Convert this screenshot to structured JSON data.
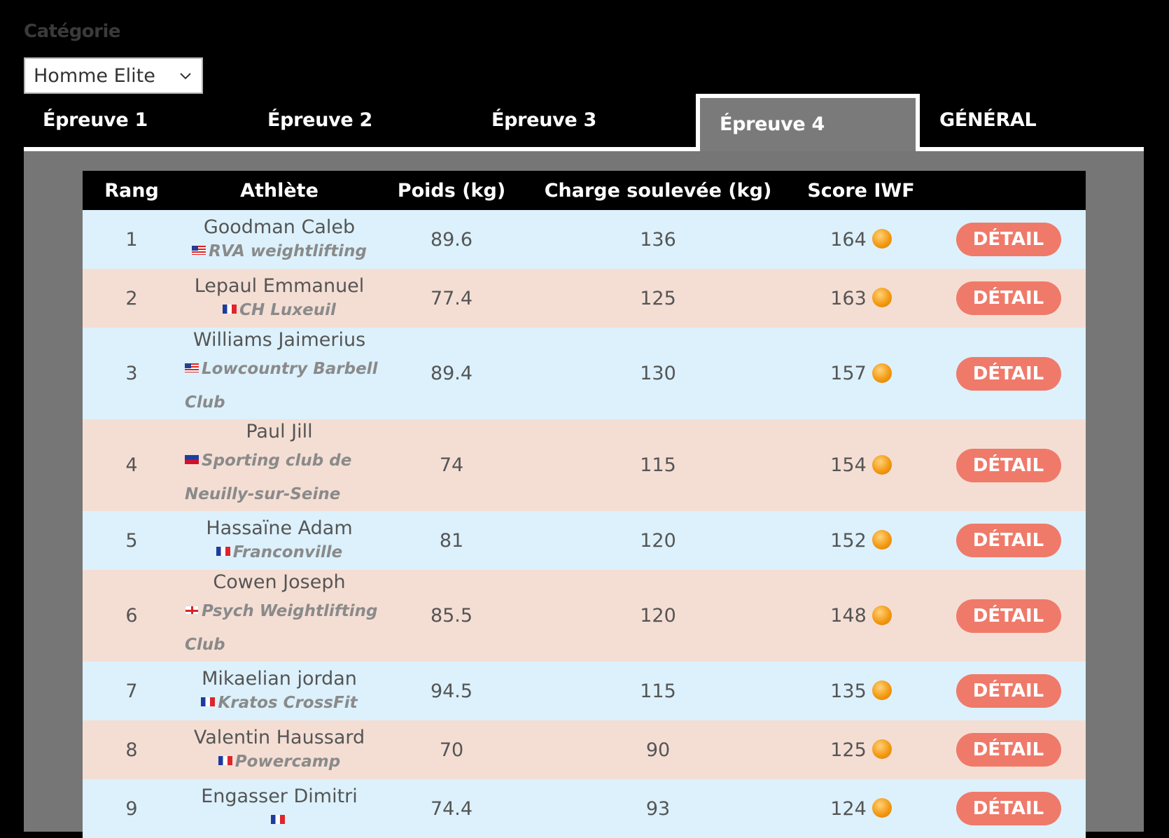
{
  "category": {
    "label": "Catégorie",
    "selected": "Homme Elite"
  },
  "tabs": [
    {
      "label": "Épreuve 1",
      "active": false
    },
    {
      "label": "Épreuve 2",
      "active": false
    },
    {
      "label": "Épreuve 3",
      "active": false
    },
    {
      "label": "Épreuve 4",
      "active": true
    },
    {
      "label": "GÉNÉRAL",
      "active": false
    }
  ],
  "table": {
    "headers": {
      "rank": "Rang",
      "athlete": "Athlète",
      "weight": "Poids (kg)",
      "load": "Charge soulevée (kg)",
      "score": "Score IWF",
      "detail": ""
    },
    "detail_label": "DÉTAIL",
    "rows": [
      {
        "rank": "1",
        "name": "Goodman Caleb",
        "flag": "us",
        "club1": "RVA weightlifting",
        "club2": "",
        "weight": "89.6",
        "load": "136",
        "score": "164"
      },
      {
        "rank": "2",
        "name": "Lepaul Emmanuel",
        "flag": "fr",
        "club1": "CH Luxeuil",
        "club2": "",
        "weight": "77.4",
        "load": "125",
        "score": "163"
      },
      {
        "rank": "3",
        "name": "Williams Jaimerius",
        "flag": "us",
        "club1": "Lowcountry Barbell",
        "club2": "Club",
        "weight": "89.4",
        "load": "130",
        "score": "157"
      },
      {
        "rank": "4",
        "name": "Paul Jill",
        "flag": "ht",
        "club1": "Sporting club de",
        "club2": "Neuilly-sur-Seine",
        "weight": "74",
        "load": "115",
        "score": "154"
      },
      {
        "rank": "5",
        "name": "Hassaïne Adam",
        "flag": "fr",
        "club1": "Franconville",
        "club2": "",
        "weight": "81",
        "load": "120",
        "score": "152"
      },
      {
        "rank": "6",
        "name": "Cowen Joseph",
        "flag": "en",
        "club1": "Psych Weightlifting",
        "club2": "Club",
        "weight": "85.5",
        "load": "120",
        "score": "148"
      },
      {
        "rank": "7",
        "name": "Mikaelian jordan",
        "flag": "fr",
        "club1": "Kratos CrossFit",
        "club2": "",
        "weight": "94.5",
        "load": "115",
        "score": "135"
      },
      {
        "rank": "8",
        "name": "Valentin Haussard",
        "flag": "fr",
        "club1": "Powercamp",
        "club2": "",
        "weight": "70",
        "load": "90",
        "score": "125"
      },
      {
        "rank": "9",
        "name": "Engasser Dimitri",
        "flag": "fr",
        "club1": "",
        "club2": "",
        "weight": "74.4",
        "load": "93",
        "score": "124"
      }
    ]
  }
}
